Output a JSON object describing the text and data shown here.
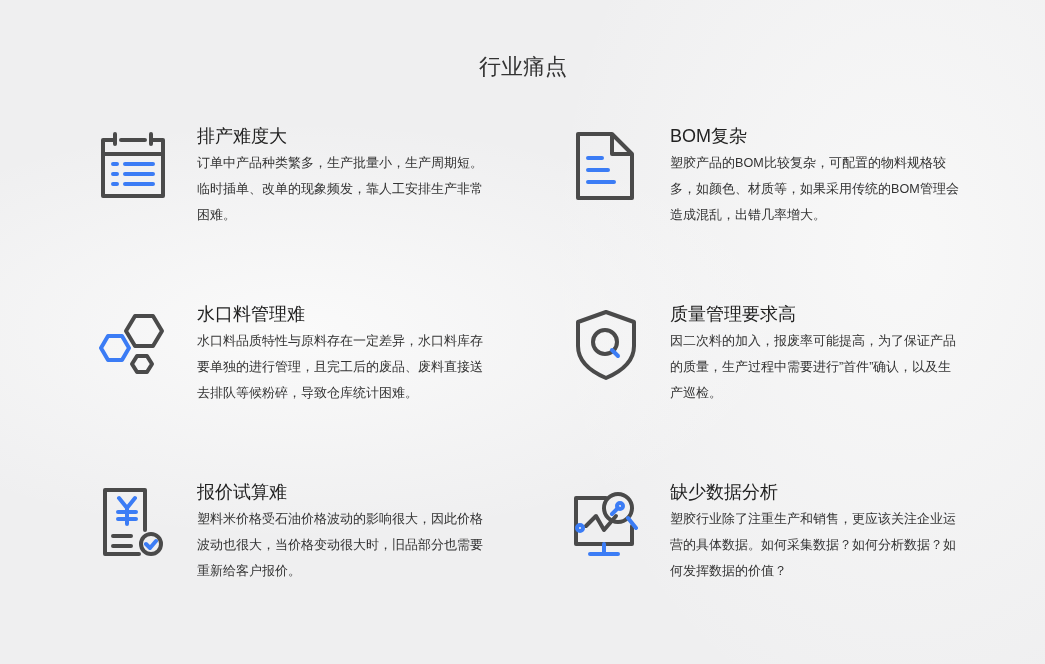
{
  "title": "行业痛点",
  "items": [
    {
      "kind": "calendar",
      "title": "排产难度大",
      "text": "订单中产品种类繁多，生产批量小，生产周期短。临时插单、改单的现象频发，靠人工安排生产非常困难。"
    },
    {
      "kind": "document",
      "title": "BOM复杂",
      "text": "塑胶产品的BOM比较复杂，可配置的物料规格较多，如颜色、材质等，如果采用传统的BOM管理会造成混乱，出错几率增大。"
    },
    {
      "kind": "hexagons",
      "title": "水口料管理难",
      "text": "水口料品质特性与原料存在一定差异，水口料库存要单独的进行管理，且完工后的废品、废料直接送去排队等候粉碎，导致仓库统计困难。"
    },
    {
      "kind": "shield",
      "title": "质量管理要求高",
      "text": "因二次料的加入，报废率可能提高，为了保证产品的质量，生产过程中需要进行”首件”确认，以及生产巡检。"
    },
    {
      "kind": "invoice",
      "title": "报价试算难",
      "text": "塑料米价格受石油价格波动的影响很大，因此价格波动也很大，当价格变动很大时，旧品部分也需要重新给客户报价。"
    },
    {
      "kind": "analytics",
      "title": "缺少数据分析",
      "text": "塑胶行业除了注重生产和销售，更应该关注企业运营的具体数据。如何采集数据？如何分析数据？如何发挥数据的价值？"
    }
  ]
}
